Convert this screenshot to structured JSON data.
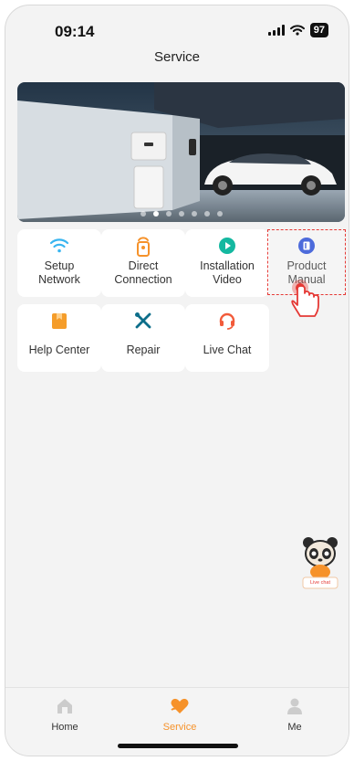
{
  "status_bar": {
    "time": "09:14",
    "battery": "97"
  },
  "header": {
    "title": "Service"
  },
  "banner": {
    "slide_count": 7,
    "active_slide": 1
  },
  "tiles": [
    {
      "line1": "Setup",
      "line2": "Network",
      "icon": "wifi-icon"
    },
    {
      "line1": "Direct",
      "line2": "Connection",
      "icon": "device-connect-icon"
    },
    {
      "line1": "Installation",
      "line2": "Video",
      "icon": "play-icon"
    },
    {
      "line1": "Product",
      "line2": "Manual",
      "icon": "manual-book-icon"
    },
    {
      "line1": "Help Center",
      "line2": "",
      "icon": "help-center-icon"
    },
    {
      "line1": "Repair",
      "line2": "",
      "icon": "wrench-screwdriver-icon"
    },
    {
      "line1": "Live Chat",
      "line2": "",
      "icon": "headset-icon"
    }
  ],
  "mascot": {
    "label": "Live chat"
  },
  "tabbar": {
    "items": [
      {
        "label": "Home",
        "icon": "home-icon",
        "active": false
      },
      {
        "label": "Service",
        "icon": "service-heart-icon",
        "active": true
      },
      {
        "label": "Me",
        "icon": "person-icon",
        "active": false
      }
    ]
  },
  "colors": {
    "accent": "#f6922a",
    "wifi": "#39b5f0",
    "play": "#14b8a0",
    "manual": "#2146d3",
    "help": "#f59d2a",
    "repair": "#0d6e8a",
    "chat": "#f25b3a",
    "inactive": "#8a8a8a"
  }
}
